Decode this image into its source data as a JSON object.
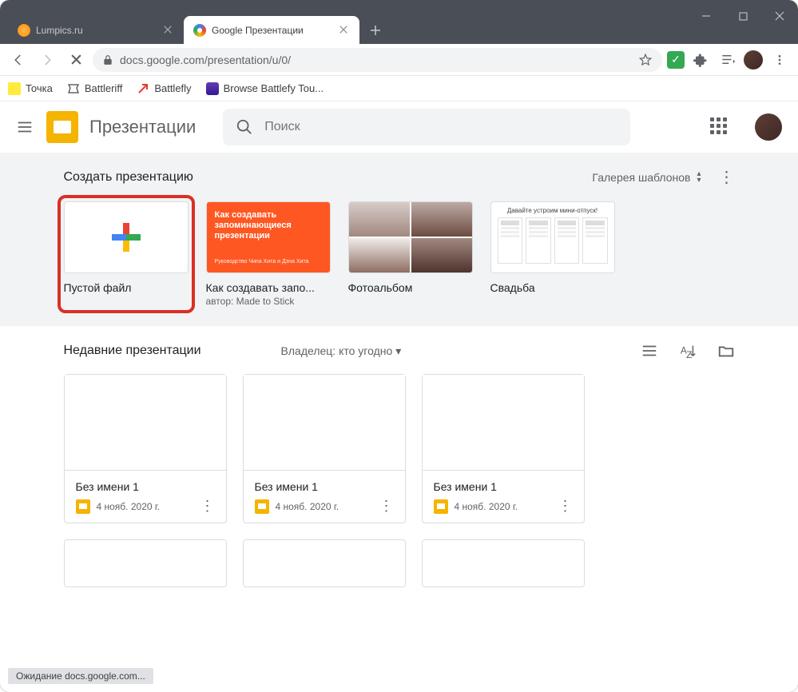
{
  "browser": {
    "tabs": [
      {
        "title": "Lumpics.ru",
        "active": false
      },
      {
        "title": "Google Презентации",
        "active": true
      }
    ],
    "url_display": "docs.google.com/presentation/u/0/",
    "bookmarks": [
      {
        "label": "Точка"
      },
      {
        "label": "Battleriff"
      },
      {
        "label": "Battlefly"
      },
      {
        "label": "Browse Battlefy Tou..."
      }
    ],
    "status_text": "Ожидание docs.google.com..."
  },
  "app": {
    "title": "Презентации",
    "search_placeholder": "Поиск",
    "templates": {
      "heading": "Создать презентацию",
      "gallery_label": "Галерея шаблонов",
      "items": [
        {
          "label": "Пустой файл",
          "kind": "blank",
          "highlighted": true
        },
        {
          "label": "Как создавать запо...",
          "kind": "orange",
          "author": "автор: Made to Stick",
          "thumb_title": "Как создавать запоминающиеся презентации",
          "thumb_footer": "Руководство Чипа Хита и Дэна Хита"
        },
        {
          "label": "Фотоальбом",
          "kind": "photo"
        },
        {
          "label": "Свадьба",
          "kind": "wedding",
          "thumb_title": "Давайте устроим мини-отпуск!"
        }
      ]
    },
    "recent": {
      "heading": "Недавние презентации",
      "owner_filter": "Владелец: кто угодно",
      "files": [
        {
          "name": "Без имени 1",
          "date": "4 нояб. 2020 г."
        },
        {
          "name": "Без имени 1",
          "date": "4 нояб. 2020 г."
        },
        {
          "name": "Без имени 1",
          "date": "4 нояб. 2020 г."
        }
      ]
    }
  }
}
